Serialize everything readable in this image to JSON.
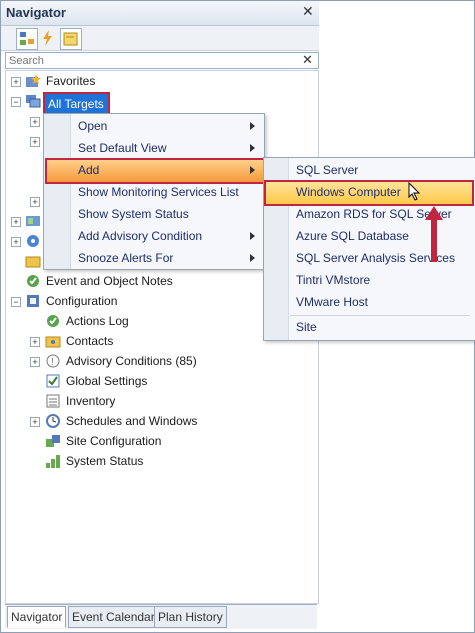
{
  "window": {
    "title": "Navigator",
    "close": "✕"
  },
  "search": {
    "placeholder": "Search",
    "clear": "✕"
  },
  "tree": {
    "favorites": "Favorites",
    "all_targets": "All Targets",
    "event_notes": "Event and Object Notes",
    "configuration": "Configuration",
    "config_children": [
      "Actions Log",
      "Contacts",
      "Advisory Conditions (85)",
      "Global Settings",
      "Inventory",
      "Schedules and Windows",
      "Site Configuration",
      "System Status"
    ]
  },
  "context_menu": {
    "items": [
      "Open",
      "Set Default View",
      "Add",
      "Show Monitoring Services List",
      "Show System Status",
      "Add Advisory Condition",
      "Snooze Alerts For"
    ]
  },
  "add_submenu": {
    "items": [
      "SQL Server",
      "Windows Computer",
      "Amazon RDS for SQL Server",
      "Azure SQL Database",
      "SQL Server Analysis Services",
      "Tintri VMstore",
      "VMware Host",
      "Site"
    ]
  },
  "tabs": [
    "Navigator",
    "Event Calendar",
    "Plan History"
  ],
  "colors": {
    "selection": "#1e73d8",
    "highlight_border": "#c0263d",
    "menu_hover": "#f59a3c"
  }
}
